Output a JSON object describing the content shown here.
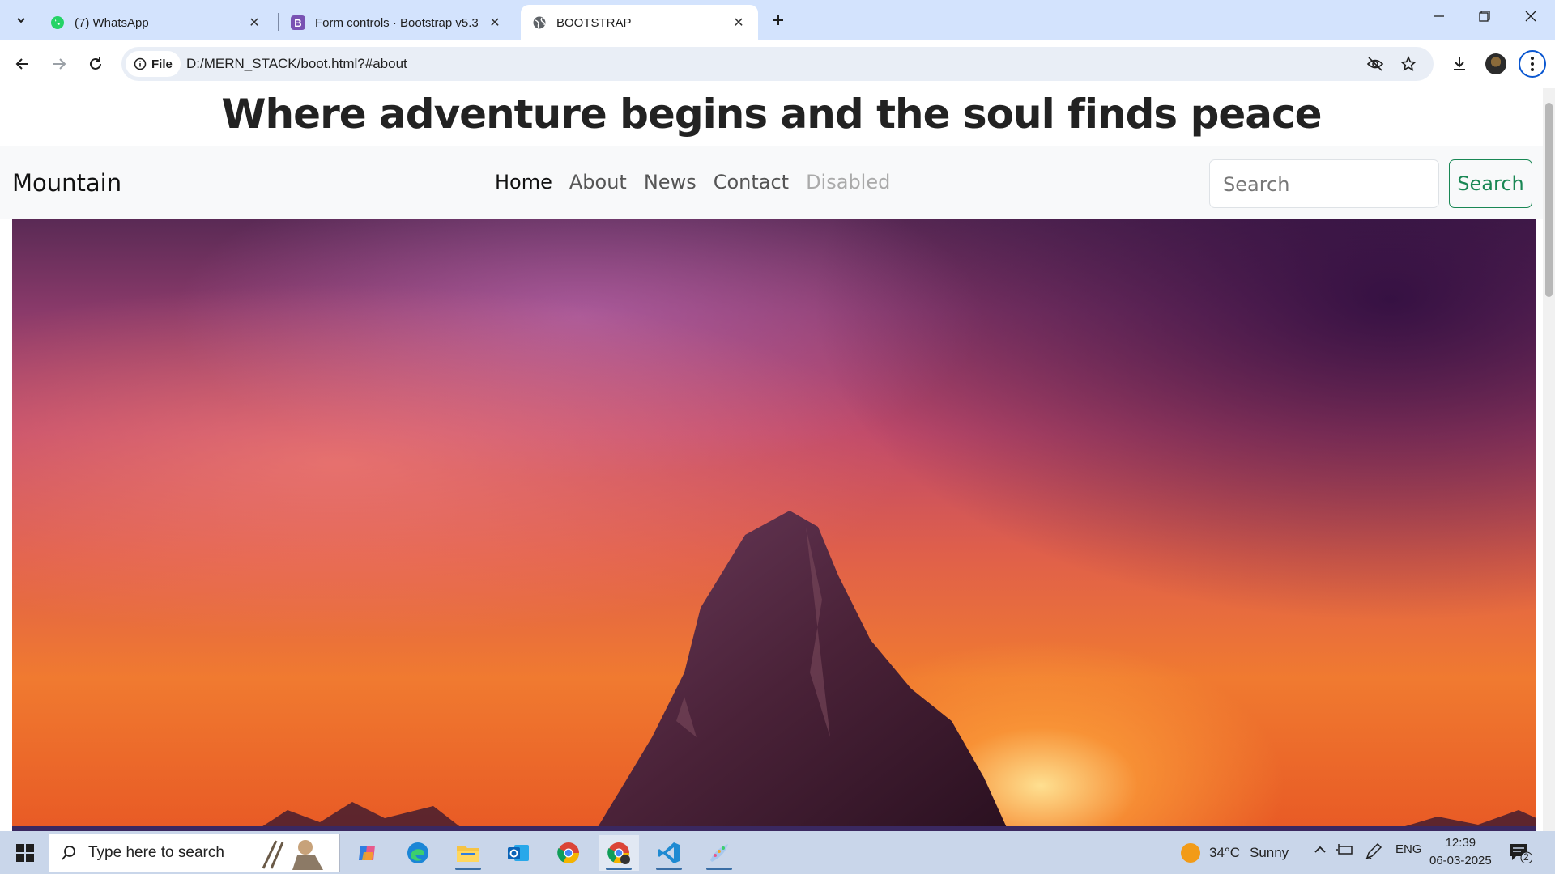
{
  "browser": {
    "tabs": [
      {
        "title": "(7) WhatsApp",
        "icon": "whatsapp-icon",
        "active": false
      },
      {
        "title": "Form controls · Bootstrap v5.3",
        "icon": "bootstrap-icon",
        "active": false
      },
      {
        "title": "BOOTSTRAP",
        "icon": "globe-icon",
        "active": true
      }
    ],
    "url_chip": "File",
    "url": "D:/MERN_STACK/boot.html?#about"
  },
  "page": {
    "heading": "Where adventure begins and the soul finds peace",
    "navbar": {
      "brand": "Mountain",
      "links": [
        "Home",
        "About",
        "News",
        "Contact",
        "Disabled"
      ],
      "active_link": "Home",
      "disabled_link": "Disabled",
      "search_placeholder": "Search",
      "search_button": "Search"
    },
    "hero_image": "mountain-sunset-image"
  },
  "taskbar": {
    "search_placeholder": "Type here to search",
    "weather": {
      "temp": "34°C",
      "condition": "Sunny"
    },
    "language": "ENG",
    "time": "12:39",
    "date": "06-03-2025",
    "notifications": "2"
  },
  "colors": {
    "tabstrip": "#d3e3fd",
    "success": "#198754",
    "taskbar": "#c9d6ea"
  }
}
